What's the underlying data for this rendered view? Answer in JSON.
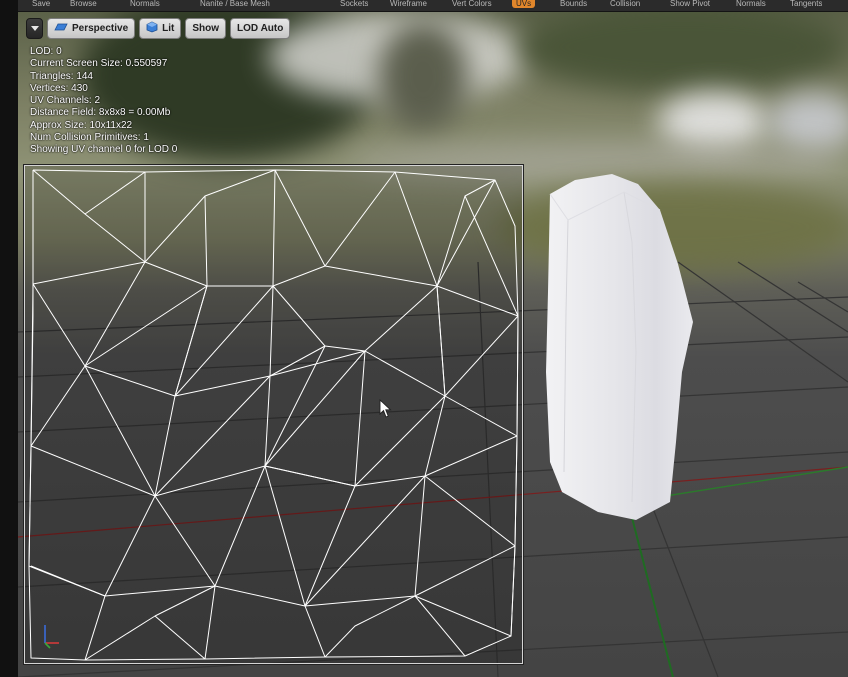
{
  "menu_bar": {
    "tabs": [
      "Save",
      "Browse",
      "Normals",
      "Nanite / Base Mesh",
      "Sockets",
      "Wireframe",
      "Vert Colors",
      "UVs",
      "Bounds",
      "Collision",
      "Show Pivot",
      "Normals",
      "Tangents"
    ],
    "active_index": 7
  },
  "viewport_toolbar": {
    "perspective_label": "Perspective",
    "lit_label": "Lit",
    "show_label": "Show",
    "lod_label": "LOD Auto"
  },
  "stats": {
    "lod": "LOD:  0",
    "screen_size": "Current Screen Size:  0.550597",
    "triangles": "Triangles:  144",
    "vertices": "Vertices:  430",
    "uv_channels": "UV Channels:  2",
    "distance_field": "Distance Field:  8x8x8 = 0.00Mb",
    "approx_size": "Approx Size: 10x11x22",
    "collision": "Num Collision Primitives:  1",
    "showing": "Showing UV channel 0 for LOD 0"
  },
  "colors": {
    "toolbar_button": "#d6d6d6",
    "active_tab": "#e0862b",
    "wireframe": "#ffffff",
    "rock": "#e9e9ec"
  }
}
